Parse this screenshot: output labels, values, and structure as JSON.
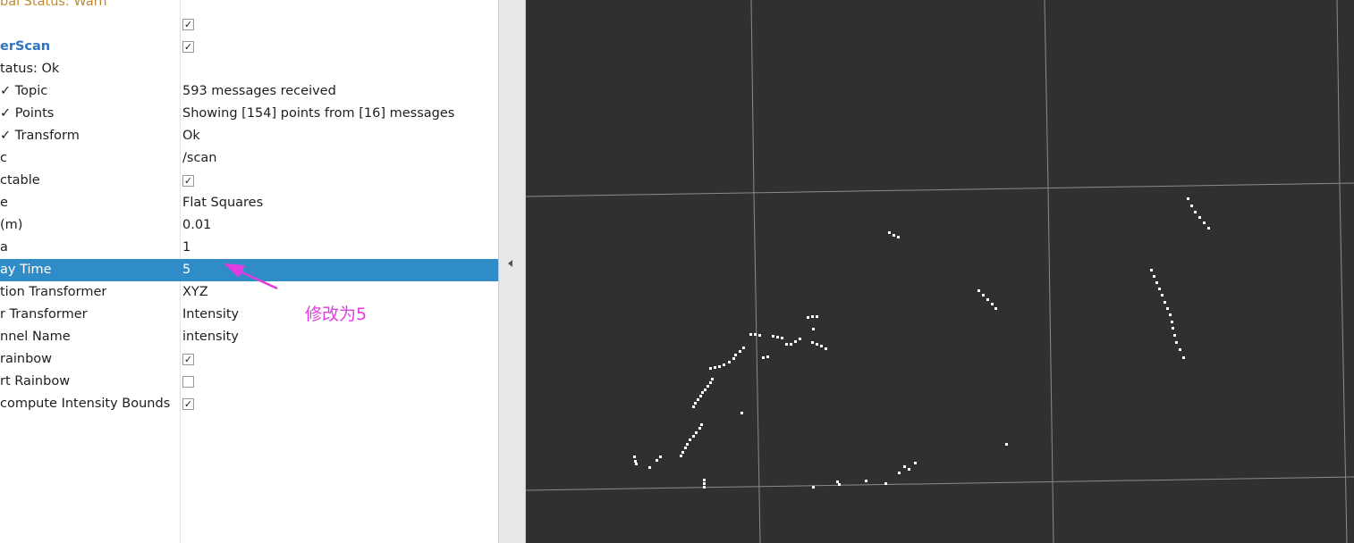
{
  "properties": [
    {
      "name": "bal Status: Warn",
      "value": "",
      "type": "status-warn"
    },
    {
      "name": "",
      "checkbox": true
    },
    {
      "name": "erScan",
      "checkbox": true,
      "type": "display-name"
    },
    {
      "name": "tatus: Ok",
      "value": ""
    },
    {
      "name": "✓ Topic",
      "value": "593 messages received"
    },
    {
      "name": "✓ Points",
      "value": "Showing [154] points from [16] messages"
    },
    {
      "name": "✓ Transform",
      "value": "Ok"
    },
    {
      "name": "c",
      "value": "/scan"
    },
    {
      "name": "ctable",
      "checkbox": true
    },
    {
      "name": "e",
      "value": "Flat Squares"
    },
    {
      "name": "(m)",
      "value": "0.01"
    },
    {
      "name": "a",
      "value": "1"
    },
    {
      "name": "ay Time",
      "value": "5",
      "selected": true
    },
    {
      "name": "tion Transformer",
      "value": "XYZ"
    },
    {
      "name": "r Transformer",
      "value": "Intensity"
    },
    {
      "name": "nnel Name",
      "value": "intensity"
    },
    {
      "name": "rainbow",
      "checkbox": true
    },
    {
      "name": "rt Rainbow",
      "checkbox": false
    },
    {
      "name": "compute Intensity Bounds",
      "checkbox": true
    }
  ],
  "annotation": {
    "text": "修改为5"
  },
  "colors": {
    "selection": "#308cc6",
    "warn_text": "#c0892f",
    "display_name": "#2f73c0",
    "annotation": "#e23be2",
    "viewport_bg": "#303030",
    "grid": "#8a8a8a",
    "scan_points": "#ffffff"
  },
  "icons": {
    "splitter": "collapse-left-arrow-icon",
    "annotation_arrow": "pointer-arrow-icon"
  }
}
